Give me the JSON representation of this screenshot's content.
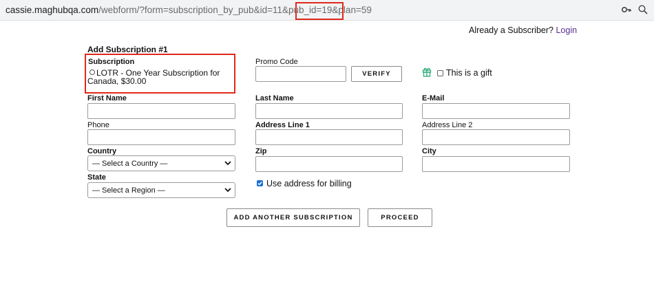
{
  "browser": {
    "url_host": "cassie.maghubqa.com",
    "url_path": "/webform/?form=subscription_by_pub&id=11&pub_id=19&plan=59"
  },
  "header": {
    "subscriber_prompt": "Already a Subscriber?",
    "login_link": "Login"
  },
  "form": {
    "title": "Add Subscription #1",
    "subscription_label": "Subscription",
    "subscription_option_line1": "LOTR - One Year Subscription for",
    "subscription_option_line2": "Canada, $30.00",
    "promo_label": "Promo Code",
    "promo_value": "",
    "verify_button": "VERIFY",
    "gift_label": "This is a gift",
    "gift_checked": false,
    "first_name_label": "First Name",
    "last_name_label": "Last Name",
    "email_label": "E-Mail",
    "phone_label": "Phone",
    "address1_label": "Address Line 1",
    "address2_label": "Address Line 2",
    "country_label": "Country",
    "country_selected": "— Select a Country —",
    "zip_label": "Zip",
    "city_label": "City",
    "state_label": "State",
    "state_selected": "— Select a Region —",
    "billing_label": "Use address for billing",
    "billing_checked": true,
    "add_another_button": "ADD ANOTHER SUBSCRIPTION",
    "proceed_button": "PROCEED"
  },
  "colors": {
    "highlight": "#e0281b",
    "link": "#5b2d91",
    "gift_icon": "#2aa876",
    "checkbox": "#1a6ed8"
  }
}
